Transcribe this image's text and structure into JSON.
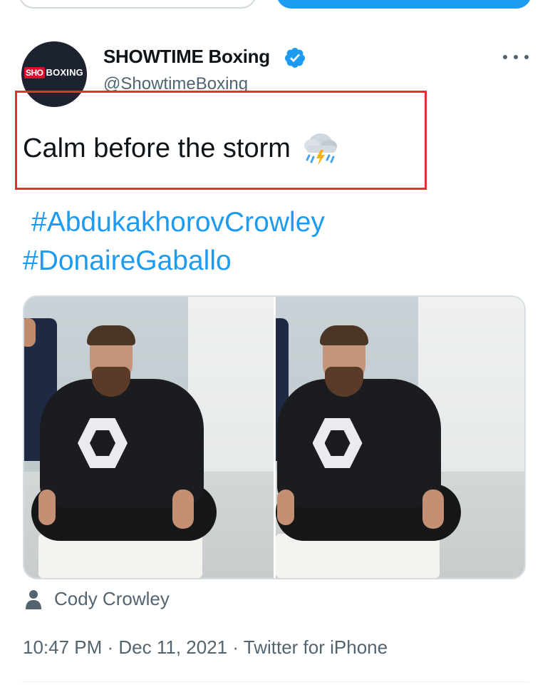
{
  "avatar": {
    "logo_sho": "SHO",
    "logo_boxing": "BOXING"
  },
  "author": {
    "display_name": "SHOWTIME Boxing",
    "handle": "@ShowtimeBoxing",
    "verified": true
  },
  "tweet": {
    "text": "Calm before the storm",
    "emoji": "thunder-cloud-and-rain-icon",
    "hashtags": [
      "#AbdukakhorovCrowley",
      "#DonaireGaballo"
    ]
  },
  "media_tag": {
    "name": "Cody Crowley"
  },
  "meta": {
    "timestamp": "10:47 PM · Dec 11, 2021 · Twitter for iPhone"
  },
  "colors": {
    "accent": "#1d9bf0",
    "text": "#0f1419",
    "secondary": "#536471",
    "highlight": "#e2322f"
  }
}
